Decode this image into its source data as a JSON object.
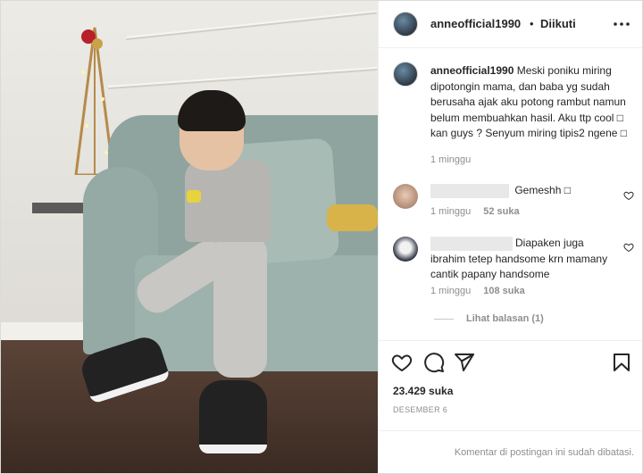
{
  "post": {
    "username": "anneofficial1990",
    "separator": "•",
    "follow_status": "Diikuti",
    "more_icon": "more-horizontal-icon"
  },
  "caption": {
    "username": "anneofficial1990",
    "text": "Meski poniku miring dipotongin mama, dan baba yg sudah berusaha ajak aku potong rambut namun belum membuahkan hasil. Aku ttp cool □ kan guys ? Senyum miring tipis2 ngene □",
    "time": "1 minggu"
  },
  "comments": [
    {
      "text": "Gemeshh □",
      "time": "1 minggu",
      "likes": "52 suka"
    },
    {
      "text": "Diapaken juga ibrahim tetep handsome krn mamany cantik papany handsome",
      "time": "1 minggu",
      "likes": "108 suka",
      "replies_label": "Lihat balasan (1)"
    }
  ],
  "likes_count": "23.429 suka",
  "date": "DESEMBER 6",
  "comments_disabled": "Komentar di postingan ini sudah dibatasi.",
  "icons": {
    "like": "heart-icon",
    "comment": "comment-icon",
    "share": "share-icon",
    "save": "bookmark-icon"
  },
  "colors": {
    "text": "#262626",
    "muted": "#8e8e8e",
    "border": "#dbdbdb"
  }
}
